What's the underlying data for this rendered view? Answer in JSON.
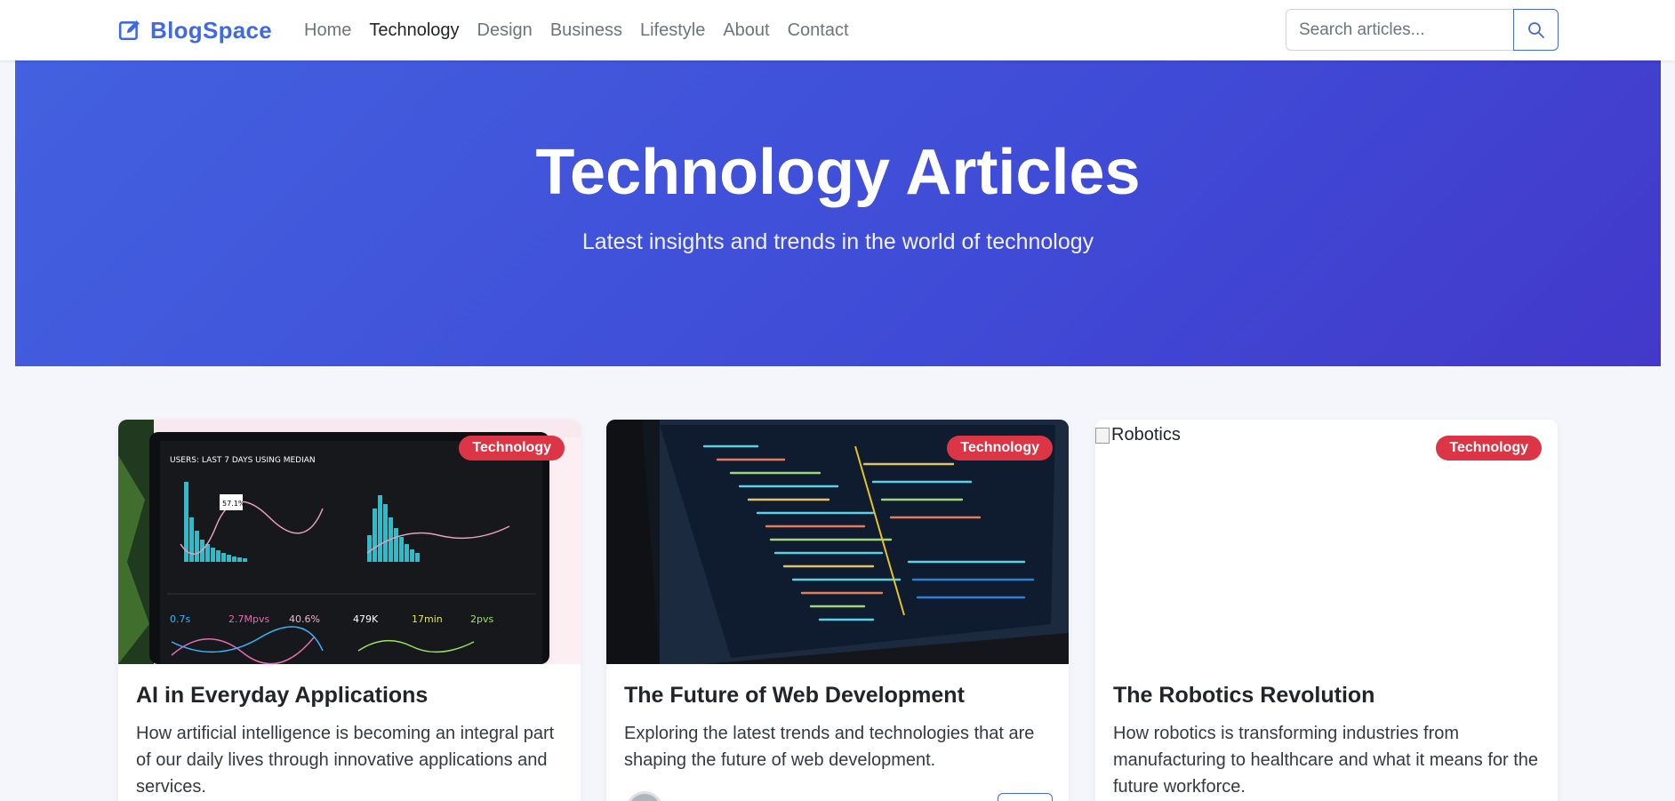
{
  "navbar": {
    "brand": "BlogSpace",
    "links": [
      "Home",
      "Technology",
      "Design",
      "Business",
      "Lifestyle",
      "About",
      "Contact"
    ],
    "active_link": "Technology",
    "search_placeholder": "Search articles...",
    "brand_icon": "edit-square-icon",
    "search_icon": "search-icon"
  },
  "hero": {
    "title": "Technology Articles",
    "subtitle": "Latest insights and trends in the world of technology"
  },
  "cards": [
    {
      "badge": "Technology",
      "title": "AI in Everyday Applications",
      "text": "How artificial intelligence is becoming an integral part of our daily lives through innovative applications and services."
    },
    {
      "badge": "Technology",
      "title": "The Future of Web Development",
      "text": "Exploring the latest trends and technologies that are shaping the future of web development."
    },
    {
      "badge": "Technology",
      "title": "The Robotics Revolution",
      "text": "How robotics is transforming industries from manufacturing to healthcare and what it means for the future workforce.",
      "image_alt": "Robotics"
    }
  ],
  "colors": {
    "brand": "#4169e1",
    "hero_start": "#4361e0",
    "hero_end": "#4338ca",
    "badge": "#dc3545",
    "page_bg": "#f4f6fb"
  }
}
